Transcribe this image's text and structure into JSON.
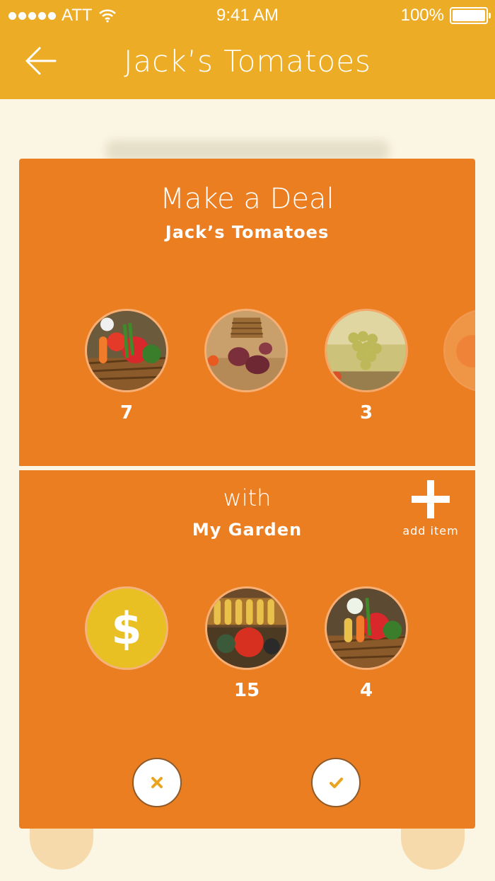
{
  "status_bar": {
    "carrier": "ATT",
    "time": "9:41 AM",
    "battery": "100%"
  },
  "nav": {
    "title": "Jack’s Tomatoes"
  },
  "deal": {
    "title": "Make a Deal",
    "subtitle": "Jack’s Tomatoes",
    "their_items": [
      {
        "count": "7",
        "icon": "vegetable-basket-image"
      },
      {
        "count": "",
        "icon": "beets-basket-image"
      },
      {
        "count": "3",
        "icon": "grapes-image"
      },
      {
        "count": "",
        "icon": "produce-image-partial"
      }
    ]
  },
  "offer": {
    "with_label": "with",
    "garden_label": "My Garden",
    "add_item_label": "add item",
    "money_symbol": "$",
    "my_items": [
      {
        "count": "15",
        "icon": "corn-tomato-basket-image"
      },
      {
        "count": "4",
        "icon": "vegetable-basket-image"
      }
    ]
  },
  "colors": {
    "header": "#ecac25",
    "panel": "#ec7e22",
    "background": "#fbf5e3",
    "money": "#e9c024"
  }
}
